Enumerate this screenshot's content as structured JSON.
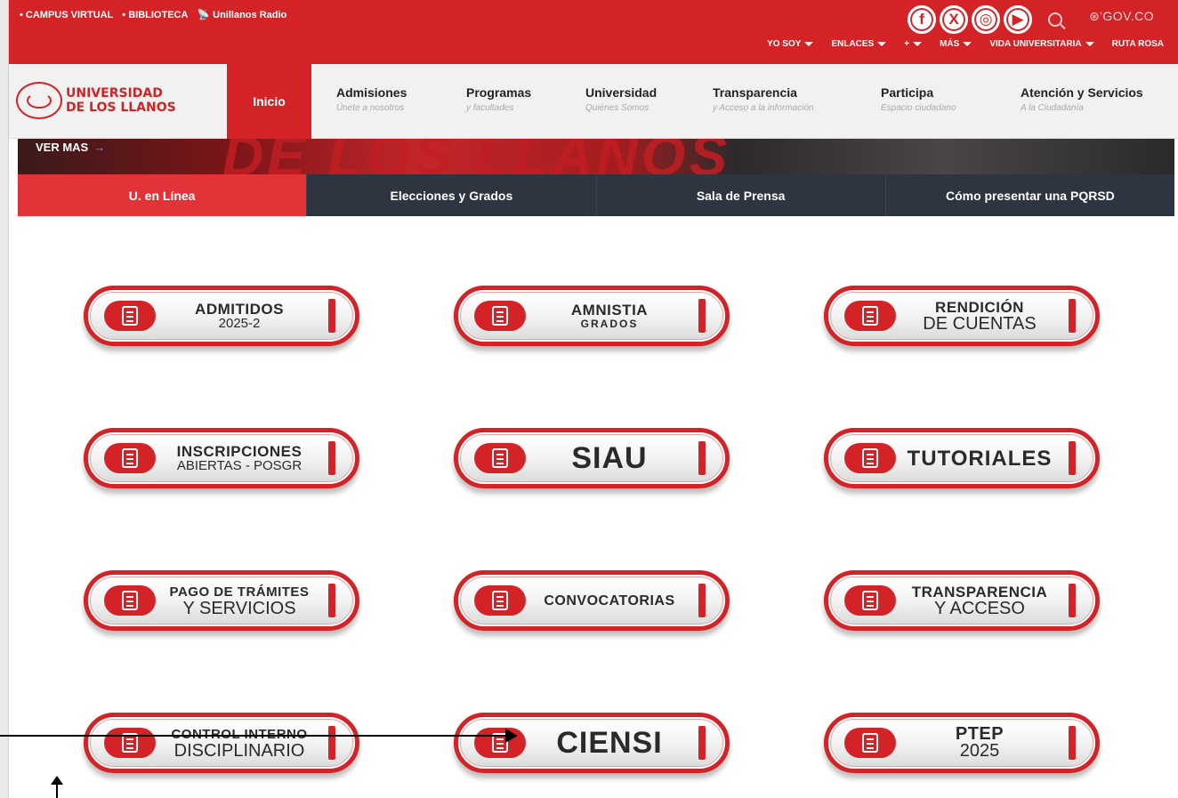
{
  "top_links": [
    "• CAMPUS VIRTUAL",
    "• BIBLIOTECA",
    "Unillanos Radio"
  ],
  "social": [
    "f",
    "X",
    "◎",
    "▶"
  ],
  "gov": "⊛'GOV.CO",
  "secondary_nav": [
    "YO SOY",
    "ENLACES",
    "+",
    "MÁS",
    "VIDA UNIVERSITARIA",
    "RUTA ROSA"
  ],
  "logo": {
    "line1": "UNIVERSIDAD",
    "line2": "DE LOS LLANOS"
  },
  "main_nav": {
    "active": "Inicio",
    "items": [
      {
        "title": "Admisiones",
        "sub": "Únete a nosotros"
      },
      {
        "title": "Programas",
        "sub": "y facultades"
      },
      {
        "title": "Universidad",
        "sub": "Quiénes Somos"
      },
      {
        "title": "Transparencia",
        "sub": "y Acceso a la información"
      },
      {
        "title": "Participa",
        "sub": "Espacio ciudadano"
      },
      {
        "title": "Atención y Servicios",
        "sub": "A la Ciudadanía"
      }
    ]
  },
  "banner": {
    "ver_mas": "VER MAS",
    "big_text": "DE LOS LLANOS"
  },
  "tabs": [
    "U. en Línea",
    "Elecciones y Grados",
    "Sala de Prensa",
    "Cómo presentar una PQRSD"
  ],
  "buttons": [
    {
      "l1": "ADMITIDOS",
      "l2": "2025-2"
    },
    {
      "l1": "AMNISTIA",
      "l2": "GRADOS"
    },
    {
      "l1": "RENDICIÓN",
      "l2": "DE CUENTAS"
    },
    {
      "l1": "INSCRIPCIONES",
      "l2": "ABIERTAS - POSGR"
    },
    {
      "l1": "SIAU"
    },
    {
      "l1": "TUTORIALES"
    },
    {
      "l1": "PAGO DE TRÁMITES",
      "l2": "Y SERVICIOS"
    },
    {
      "l1": "CONVOCATORIAS"
    },
    {
      "l1": "TRANSPARENCIA",
      "l2": "Y ACCESO"
    },
    {
      "l1": "CONTROL INTERNO",
      "l2": "DISCIPLINARIO"
    },
    {
      "l1": "CIENSI"
    },
    {
      "l1": "PTEP",
      "l2": "2025"
    }
  ],
  "colors": {
    "brand_red": "#d42327",
    "tabs_dark": "#2e3540",
    "tab_active": "#e23438"
  }
}
